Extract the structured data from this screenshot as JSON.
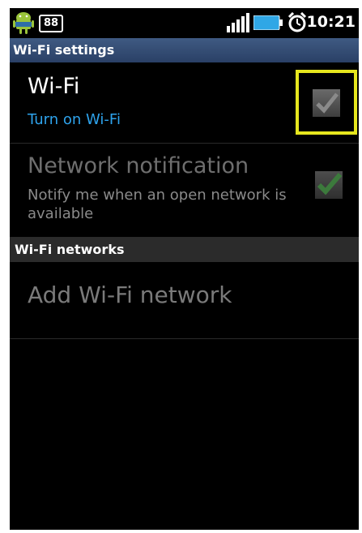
{
  "status_bar": {
    "notification_count": "88",
    "time": "10:21",
    "icons": [
      "android-robot-icon",
      "signal-bars-icon",
      "battery-icon",
      "alarm-clock-icon"
    ]
  },
  "header": {
    "title": "Wi-Fi settings"
  },
  "settings": {
    "wifi": {
      "title": "Wi-Fi",
      "subtitle": "Turn on Wi-Fi",
      "checked": false
    },
    "network_notification": {
      "title": "Network notification",
      "subtitle": "Notify me when an open network is available",
      "checked": true,
      "enabled": false
    }
  },
  "networks_section": {
    "header": "Wi-Fi networks",
    "add_label": "Add Wi-Fi network"
  },
  "colors": {
    "highlight": "#e6e61e",
    "subtitle_blue": "#2ea3ec",
    "title_bar": "#34507a",
    "check_green": "#3c7a3c"
  }
}
